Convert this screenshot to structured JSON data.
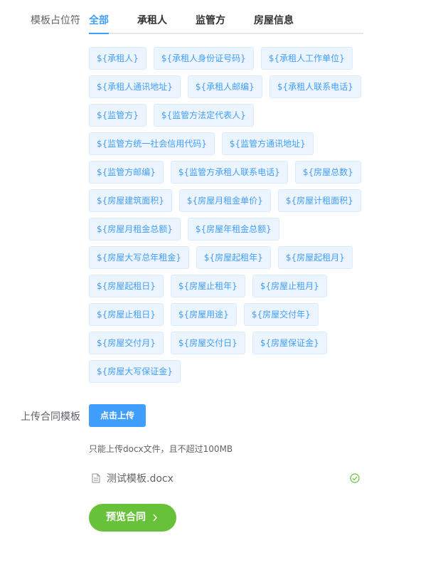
{
  "placeholder_section": {
    "label": "模板占位符",
    "tabs": [
      {
        "label": "全部",
        "active": true
      },
      {
        "label": "承租人",
        "active": false
      },
      {
        "label": "监管方",
        "active": false
      },
      {
        "label": "房屋信息",
        "active": false
      }
    ],
    "tag_rows": [
      [
        "${承租人}",
        "${承租人身份证号码}",
        "${承租人工作单位}"
      ],
      [
        "${承租人通讯地址}",
        "${承租人邮编}",
        "${承租人联系电话}"
      ],
      [
        "${监管方}",
        "${监管方法定代表人}"
      ],
      [
        "${监管方统一社会信用代码}",
        "${监管方通讯地址}"
      ],
      [
        "${监管方邮编}",
        "${监管方承租人联系电话}",
        "${房屋总数}"
      ],
      [
        "${房屋建筑面积}",
        "${房屋月租金单价}",
        "${房屋计租面积}"
      ],
      [
        "${房屋月租金总额}",
        "${房屋年租金总额}"
      ],
      [
        "${房屋大写总年租金}",
        "${房屋起租年}",
        "${房屋起租月}"
      ],
      [
        "${房屋起租日}",
        "${房屋止租年}",
        "${房屋止租月}"
      ],
      [
        "${房屋止租日}",
        "${房屋用途}",
        "${房屋交付年}"
      ],
      [
        "${房屋交付月}",
        "${房屋交付日}",
        "${房屋保证金}"
      ],
      [
        "${房屋大写保证金}"
      ]
    ]
  },
  "upload_section": {
    "label": "上传合同模板",
    "button_label": "点击上传",
    "tip": "只能上传docx文件，且不超过100MB",
    "file": {
      "name": "测试模板.docx",
      "icon": "document-icon",
      "status_icon": "success-check-icon"
    }
  },
  "preview_button": {
    "label": "预览合同",
    "icon": "chevron-right-icon"
  },
  "colors": {
    "primary": "#409eff",
    "success": "#67c23a",
    "tag_bg": "#ecf5ff",
    "tag_border": "#d9ecff"
  }
}
